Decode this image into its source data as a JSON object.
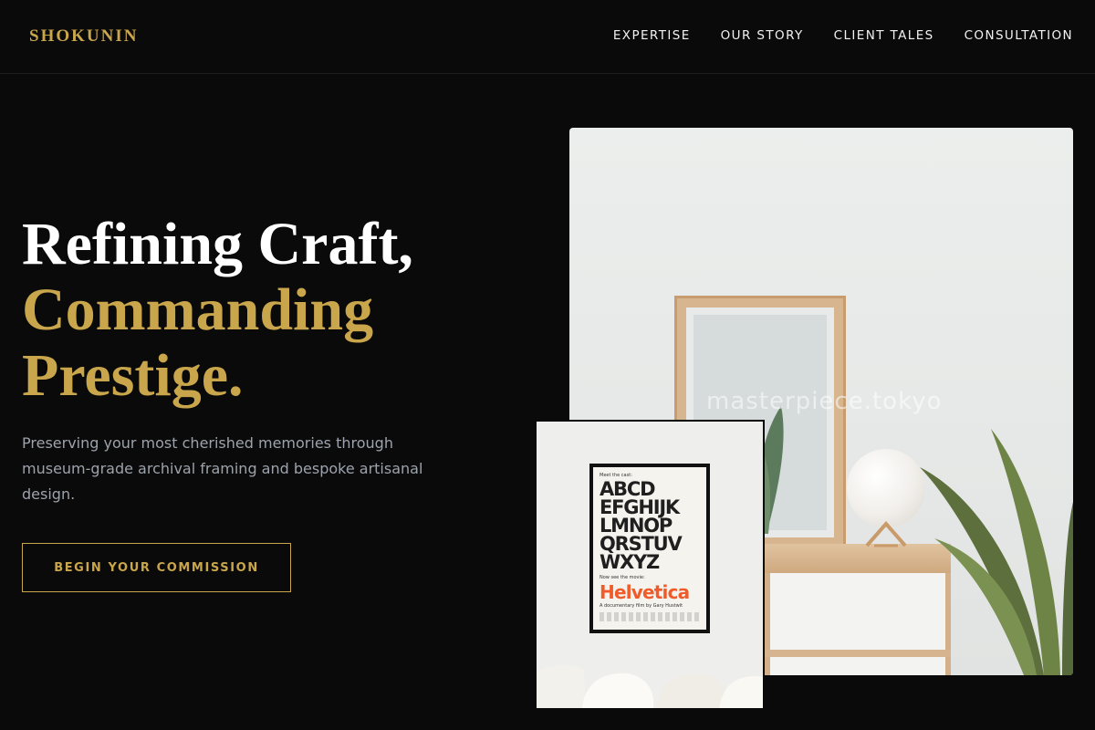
{
  "brand": "SHOKUNIN",
  "nav": {
    "items": [
      "EXPERTISE",
      "OUR STORY",
      "CLIENT TALES",
      "CONSULTATION"
    ]
  },
  "hero": {
    "title_line1": "Refining Craft,",
    "title_line2": "Commanding",
    "title_line3": "Prestige.",
    "subtitle": "Preserving your most cherished memories through museum-grade archival framing and bespoke artisanal design.",
    "cta_label": "BEGIN YOUR COMMISSION"
  },
  "gallery": {
    "main_photo_watermark": "masterpiece.tokyo",
    "poster": {
      "header": "Meet the cast:",
      "letters": [
        "ABCD",
        "EFGHIJK",
        "LMNOP",
        "QRSTUV",
        "WXYZ"
      ],
      "tagline": "Now see the movie:",
      "title": "Helvetica",
      "credit": "A documentary film by Gary Hustwit"
    }
  },
  "colors": {
    "accent": "#c9a64b",
    "background": "#0a0a0a",
    "muted_text": "#9da3ac"
  }
}
